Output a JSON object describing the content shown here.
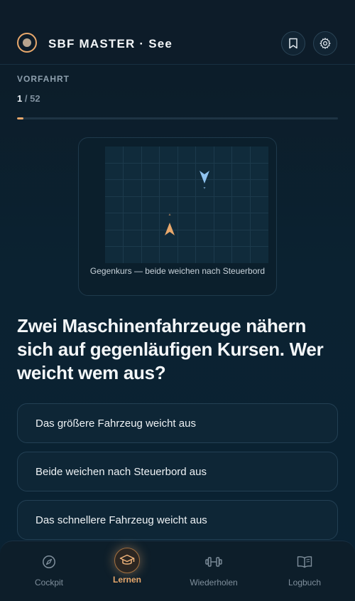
{
  "header": {
    "title": "SBF MASTER · See",
    "icons": {
      "logo": "compass-ring-logo",
      "bookmark": "bookmark-icon",
      "settings": "gear-icon"
    }
  },
  "quiz": {
    "category": "VORFAHRT",
    "current": "1",
    "total": "/ 52",
    "progress_fraction": 0.0192
  },
  "diagram": {
    "caption": "Gegenkurs — beide weichen nach Steuerbord",
    "vessels": [
      {
        "name": "own-vessel",
        "color": "#e8a86c",
        "heading": "north"
      },
      {
        "name": "other-vessel",
        "color": "#8fc3f0",
        "heading": "south"
      }
    ]
  },
  "question": {
    "text": "Zwei Maschinenfahrzeuge nähern sich auf gegenläufigen Kursen. Wer weicht wem aus?"
  },
  "answers": [
    {
      "label": "Das größere Fahrzeug weicht aus"
    },
    {
      "label": "Beide weichen nach Steuerbord aus"
    },
    {
      "label": "Das schnellere Fahrzeug weicht aus"
    }
  ],
  "nav": {
    "items": [
      {
        "label": "Cockpit",
        "icon": "compass-icon",
        "active": false
      },
      {
        "label": "Lernen",
        "icon": "graduation-cap-icon",
        "active": true
      },
      {
        "label": "Wiederholen",
        "icon": "dumbbell-icon",
        "active": false
      },
      {
        "label": "Logbuch",
        "icon": "book-icon",
        "active": false
      }
    ]
  },
  "colors": {
    "accent": "#e8a86c",
    "background": "#0b2231",
    "card_border": "#234054",
    "muted_text": "#7f8f9c"
  }
}
